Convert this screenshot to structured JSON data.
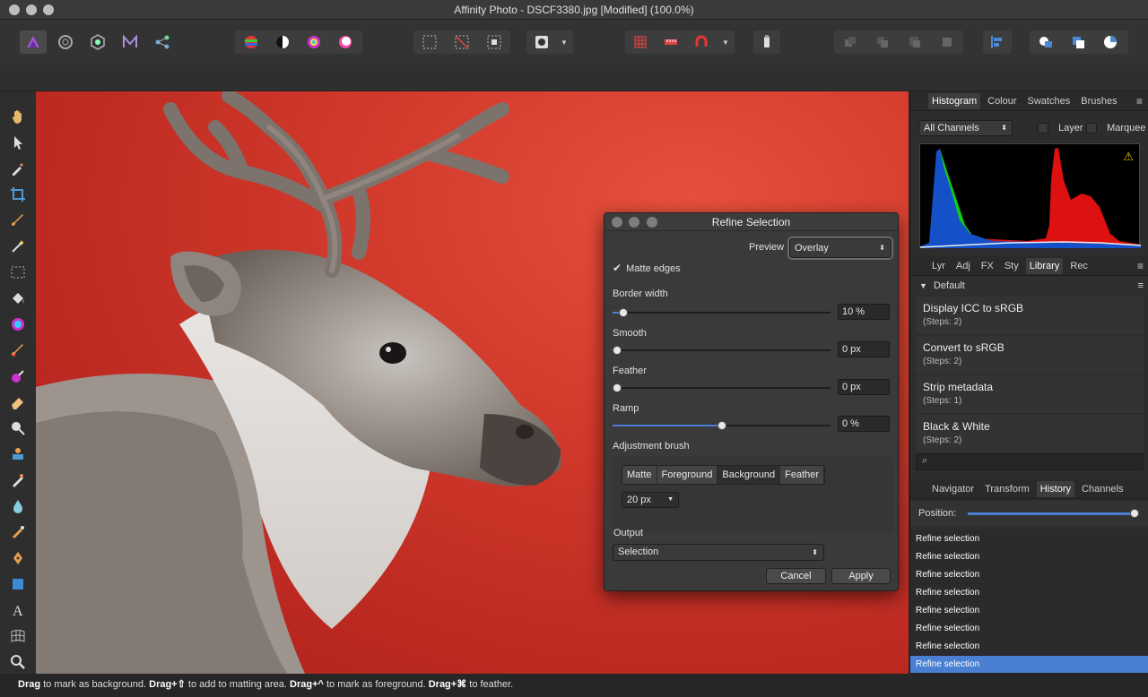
{
  "window": {
    "title": "Affinity Photo - DSCF3380.jpg [Modified] (100.0%)"
  },
  "colors": {
    "accent": "#4a7fd4",
    "canvas_red": "#d23a2c",
    "panel_bg": "#2d2d2d"
  },
  "toolbar": {
    "personas": [
      "photo-persona-icon",
      "liquify-persona-icon",
      "develop-persona-icon",
      "tone-mapping-persona-icon",
      "export-persona-icon"
    ],
    "adjust": [
      "auto-levels-icon",
      "auto-contrast-icon",
      "auto-colours-icon",
      "auto-white-balance-icon"
    ],
    "selection": [
      "select-all-icon",
      "deselect-icon",
      "invert-selection-icon"
    ],
    "quickmask": [
      "quick-mask-icon",
      "dropdown-arrow-icon"
    ],
    "snapping": [
      "snapping-grid-icon",
      "snapping-ruler-icon",
      "snapping-magnet-icon",
      "dropdown-arrow-icon"
    ],
    "assistant": [
      "assistant-icon"
    ],
    "arrange": [
      "move-back-icon",
      "move-backward-one-icon",
      "move-forward-one-icon",
      "move-front-icon"
    ],
    "align": [
      "align-icon"
    ],
    "boolean": [
      "add-icon",
      "subtract-icon",
      "intersect-icon"
    ]
  },
  "tools": [
    "hand-tool-icon",
    "move-tool-icon",
    "colour-picker-tool-icon",
    "crop-tool-icon",
    "selection-brush-tool-icon",
    "flood-select-tool-icon",
    "marquee-tool-icon",
    "flood-fill-tool-icon",
    "gradient-tool-icon",
    "paint-brush-tool-icon",
    "colour-replacement-tool-icon",
    "erase-brush-tool-icon",
    "dodge-tool-icon",
    "clone-tool-icon",
    "inpainting-tool-icon",
    "blur-tool-icon",
    "smudge-tool-icon",
    "pen-tool-icon",
    "rectangle-tool-icon",
    "text-tool-icon",
    "mesh-warp-tool-icon",
    "zoom-tool-icon"
  ],
  "status": {
    "parts": [
      {
        "b": "Drag",
        "t": " to mark as background. "
      },
      {
        "b": "Drag+⇧",
        "t": " to add to matting area. "
      },
      {
        "b": "Drag+^",
        "t": " to mark as foreground. "
      },
      {
        "b": "Drag+⌘",
        "t": " to feather."
      }
    ]
  },
  "histogram_panel": {
    "tabs": [
      "Histogram",
      "Colour",
      "Swatches",
      "Brushes"
    ],
    "active_tab": "Histogram",
    "channel_select": "All Channels",
    "layer_label": "Layer",
    "marquee_label": "Marquee"
  },
  "library_panel": {
    "tabs": [
      "Lyr",
      "Adj",
      "FX",
      "Sty",
      "Library",
      "Rec"
    ],
    "active_tab": "Library",
    "category": "Default",
    "items": [
      {
        "name": "Display ICC to sRGB",
        "steps": "(Steps: 2)"
      },
      {
        "name": "Convert to sRGB",
        "steps": "(Steps: 2)"
      },
      {
        "name": "Strip metadata",
        "steps": "(Steps: 1)"
      },
      {
        "name": "Black & White",
        "steps": "(Steps: 2)"
      }
    ],
    "search_placeholder": ""
  },
  "history_panel": {
    "tabs": [
      "Navigator",
      "Transform",
      "History",
      "Channels"
    ],
    "active_tab": "History",
    "position_label": "Position:",
    "position_value": 1.0,
    "entries": [
      "Refine selection",
      "Refine selection",
      "Refine selection",
      "Refine selection",
      "Refine selection",
      "Refine selection",
      "Refine selection",
      "Refine selection"
    ],
    "selected_index": 7
  },
  "dialog": {
    "title": "Refine Selection",
    "preview_label": "Preview",
    "preview_value": "Overlay",
    "matte_edges_label": "Matte edges",
    "matte_edges_checked": true,
    "border_width": {
      "label": "Border width",
      "value": "10 %",
      "fraction": 0.05
    },
    "smooth": {
      "label": "Smooth",
      "value": "0 px",
      "fraction": 0.0
    },
    "feather": {
      "label": "Feather",
      "value": "0 px",
      "fraction": 0.0
    },
    "ramp": {
      "label": "Ramp",
      "value": "0 %",
      "fraction": 0.5
    },
    "adjustment_brush_label": "Adjustment brush",
    "brush_modes": [
      "Matte",
      "Foreground",
      "Background",
      "Feather"
    ],
    "active_brush_mode": "Background",
    "brush_size": "20 px",
    "output_label": "Output",
    "output_value": "Selection",
    "cancel_label": "Cancel",
    "apply_label": "Apply"
  }
}
